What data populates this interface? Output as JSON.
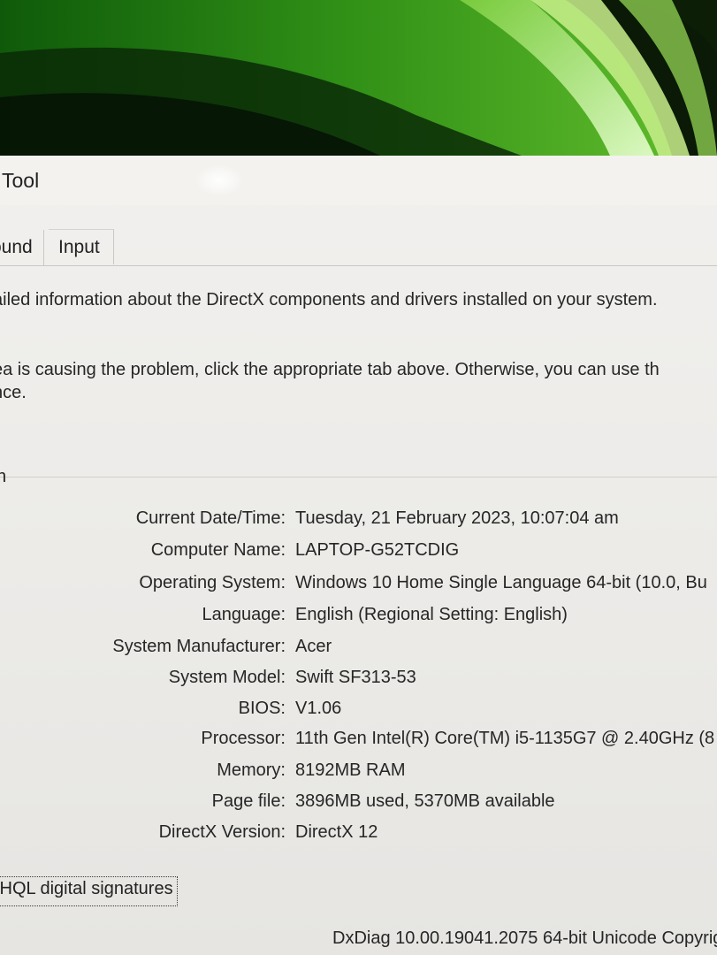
{
  "window": {
    "title": "Tool"
  },
  "tabs": [
    {
      "label": "ound"
    },
    {
      "label": "Input"
    }
  ],
  "intro": {
    "line1": "ailed information about the DirectX components and drivers installed on your system.",
    "line2": "ea is causing the problem, click the appropriate tab above.  Otherwise, you can use th",
    "line3": "nce."
  },
  "system_info": {
    "group_label": "n",
    "rows": [
      {
        "label": "Current Date/Time:",
        "value": "Tuesday, 21 February 2023, 10:07:04 am"
      },
      {
        "label": "Computer Name:",
        "value": "LAPTOP-G52TCDIG"
      },
      {
        "label": "Operating System:",
        "value": "Windows 10 Home Single Language 64-bit (10.0, Bu"
      },
      {
        "label": "Language:",
        "value": "English (Regional Setting: English)"
      },
      {
        "label": "System Manufacturer:",
        "value": "Acer"
      },
      {
        "label": "System Model:",
        "value": "Swift SF313-53"
      },
      {
        "label": "BIOS:",
        "value": "V1.06"
      },
      {
        "label": "Processor:",
        "value": "11th Gen Intel(R) Core(TM) i5-1135G7 @ 2.40GHz (8"
      },
      {
        "label": "Memory:",
        "value": "8192MB RAM"
      },
      {
        "label": "Page file:",
        "value": "3896MB used, 5370MB available"
      },
      {
        "label": "DirectX Version:",
        "value": "DirectX 12"
      }
    ]
  },
  "whql_checkbox": {
    "label": "/HQL digital signatures"
  },
  "footer": {
    "version_text": "DxDiag 10.00.19041.2075 64-bit Unicode  Copyrig"
  }
}
